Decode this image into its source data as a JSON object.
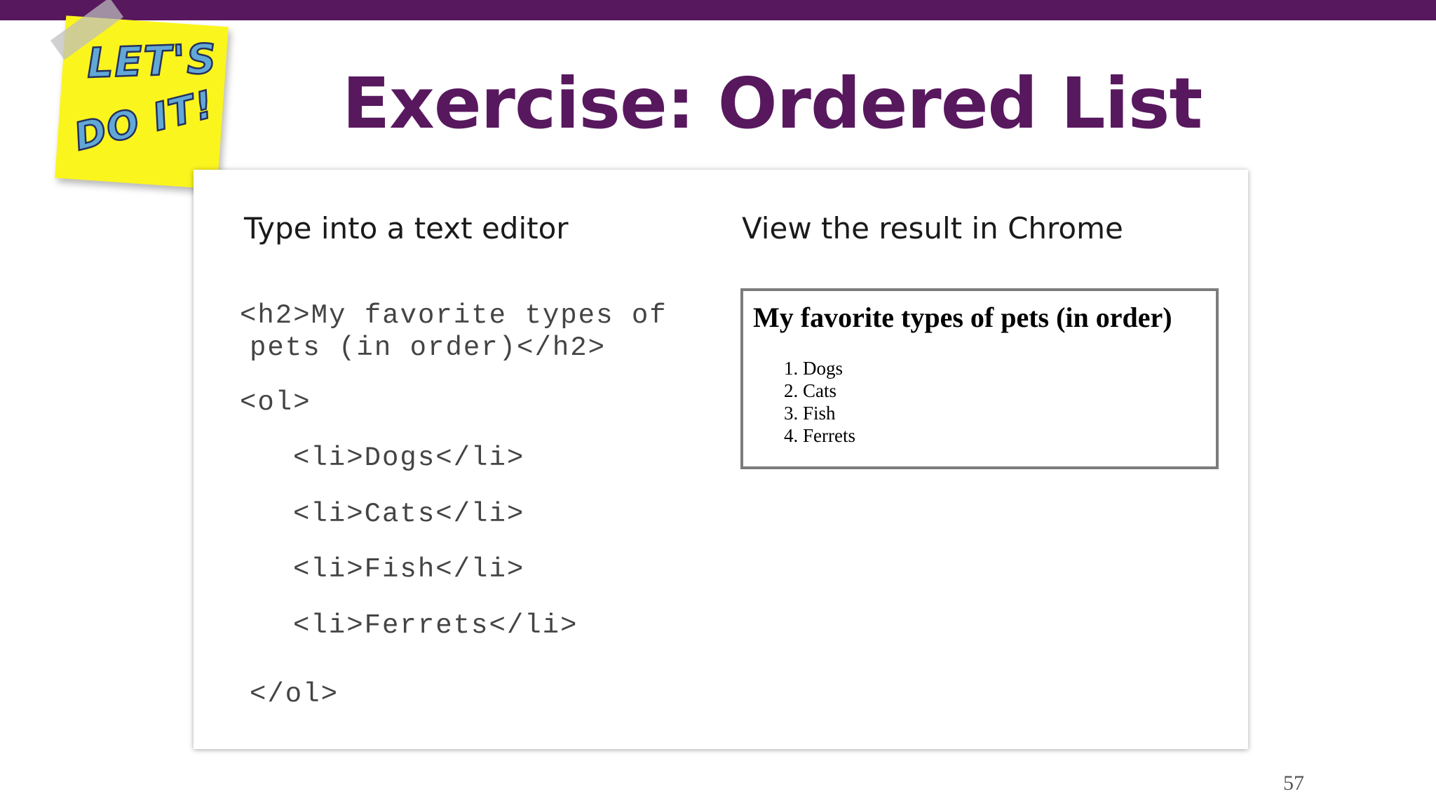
{
  "slide": {
    "title": "Exercise: Ordered List",
    "page_number": "57"
  },
  "sticky_note": {
    "line1": "LET'S",
    "line2": "DO IT!",
    "note_color": "#fbf51e",
    "text_color": "#62a8d6"
  },
  "left_column": {
    "heading": "Type into a text editor",
    "code_lines": [
      "<h2>My favorite types of",
      "pets (in order)</h2>",
      "<ol>",
      "<li>Dogs</li>",
      "<li>Cats</li>",
      "<li>Fish</li>",
      "<li>Ferrets</li>",
      "</ol>"
    ]
  },
  "right_column": {
    "heading": "View the result in Chrome",
    "result": {
      "heading": "My favorite types of pets (in order)",
      "items": [
        "1. Dogs",
        "2. Cats",
        "3. Fish",
        "4. Ferrets"
      ]
    }
  },
  "colors": {
    "accent": "#58185e",
    "code_text": "#444444"
  }
}
